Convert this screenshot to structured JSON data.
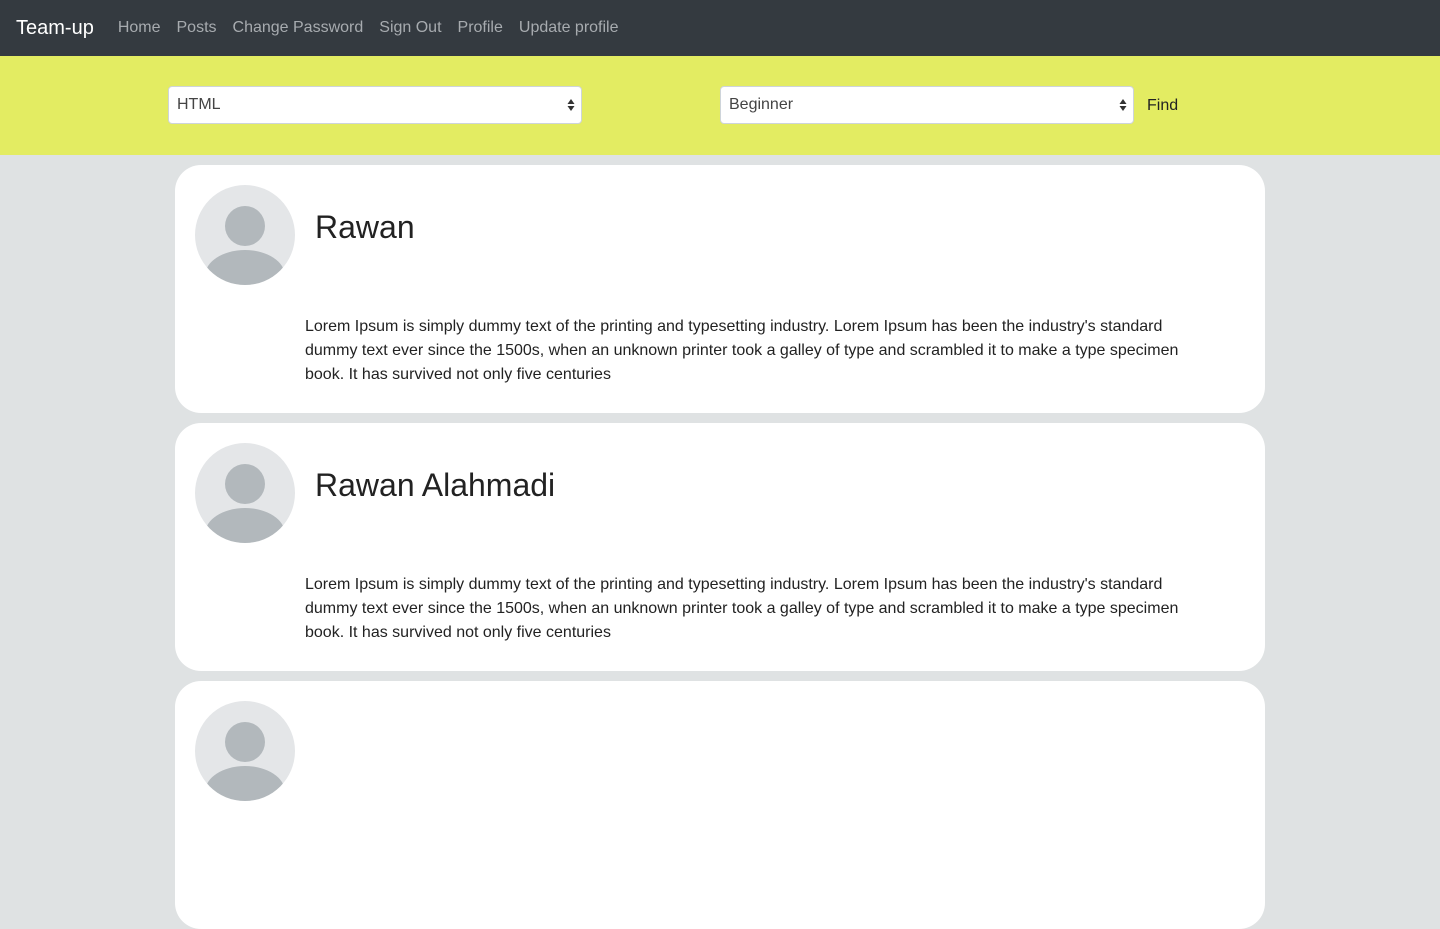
{
  "nav": {
    "brand": "Team-up",
    "links": [
      "Home",
      "Posts",
      "Change Password",
      "Sign Out",
      "Profile",
      "Update profile"
    ]
  },
  "filters": {
    "language": "HTML",
    "level": "Beginner",
    "find_label": "Find"
  },
  "colors": {
    "navbar": "#343a40",
    "filterbar": "#e3ec62",
    "page_background": "#dfe2e3",
    "card": "#ffffff"
  },
  "posts": [
    {
      "name": "Rawan",
      "description": "Lorem Ipsum is simply dummy text of the printing and typesetting industry. Lorem Ipsum has been the industry's standard dummy text ever since the 1500s, when an unknown printer took a galley of type and scrambled it to make a type specimen book. It has survived not only five centuries"
    },
    {
      "name": "Rawan Alahmadi",
      "description": "Lorem Ipsum is simply dummy text of the printing and typesetting industry. Lorem Ipsum has been the industry's standard dummy text ever since the 1500s, when an unknown printer took a galley of type and scrambled it to make a type specimen book. It has survived not only five centuries"
    }
  ]
}
